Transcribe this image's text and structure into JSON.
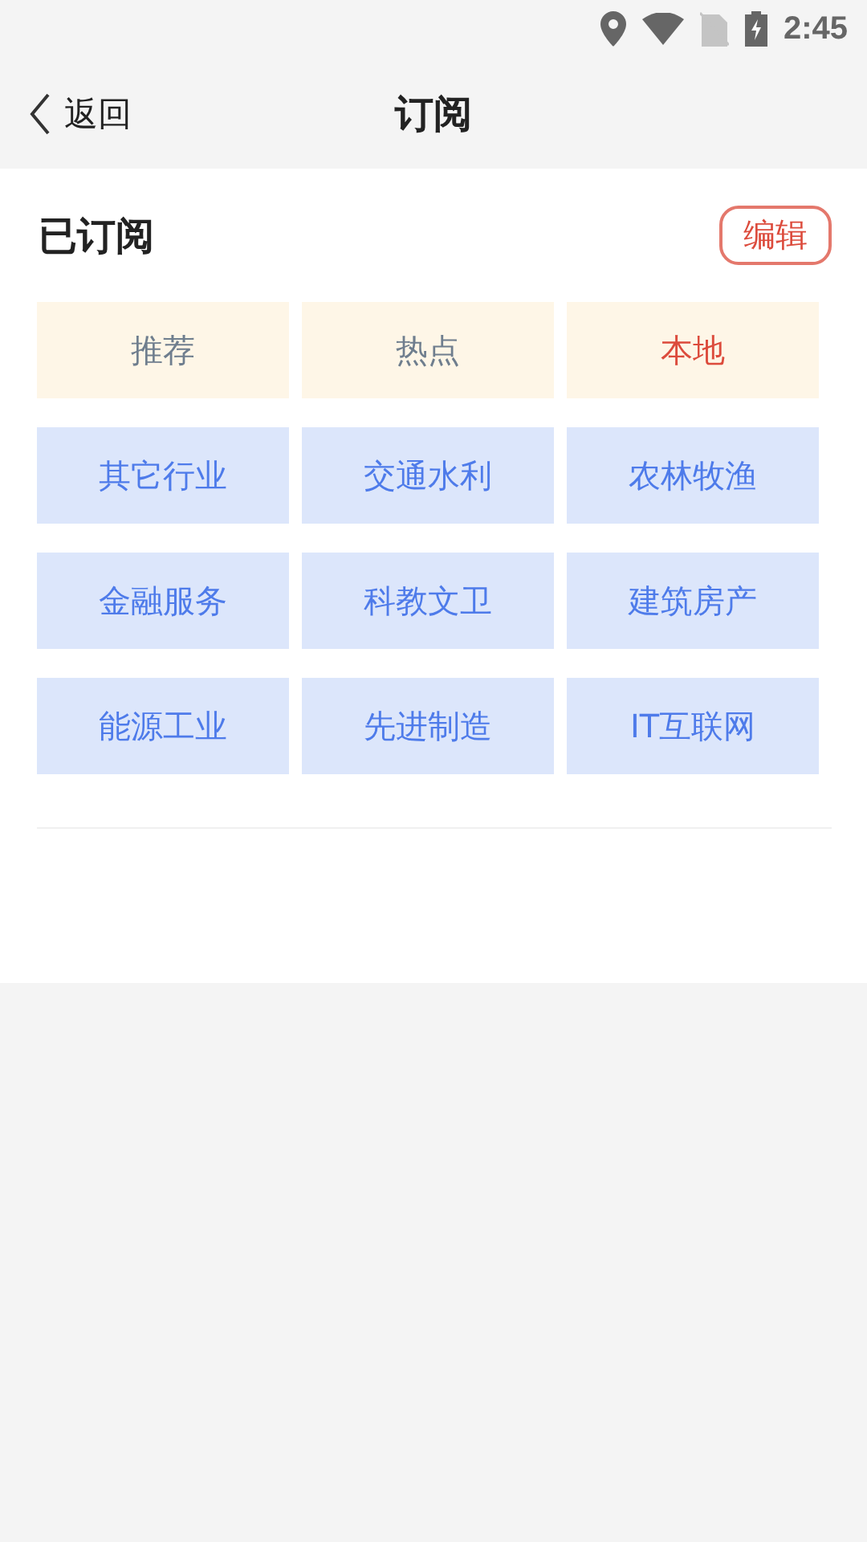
{
  "status_bar": {
    "time": "2:45"
  },
  "nav": {
    "back_label": "返回",
    "title": "订阅"
  },
  "section": {
    "title": "已订阅",
    "edit_button": "编辑"
  },
  "tiles": [
    {
      "label": "推荐",
      "kind": "fixed",
      "selected": false
    },
    {
      "label": "热点",
      "kind": "fixed",
      "selected": false
    },
    {
      "label": "本地",
      "kind": "fixed",
      "selected": true
    },
    {
      "label": "其它行业",
      "kind": "subscribed",
      "selected": false
    },
    {
      "label": "交通水利",
      "kind": "subscribed",
      "selected": false
    },
    {
      "label": "农林牧渔",
      "kind": "subscribed",
      "selected": false
    },
    {
      "label": "金融服务",
      "kind": "subscribed",
      "selected": false
    },
    {
      "label": "科教文卫",
      "kind": "subscribed",
      "selected": false
    },
    {
      "label": "建筑房产",
      "kind": "subscribed",
      "selected": false
    },
    {
      "label": "能源工业",
      "kind": "subscribed",
      "selected": false
    },
    {
      "label": "先进制造",
      "kind": "subscribed",
      "selected": false
    },
    {
      "label": "IT互联网",
      "kind": "subscribed",
      "selected": false
    }
  ]
}
